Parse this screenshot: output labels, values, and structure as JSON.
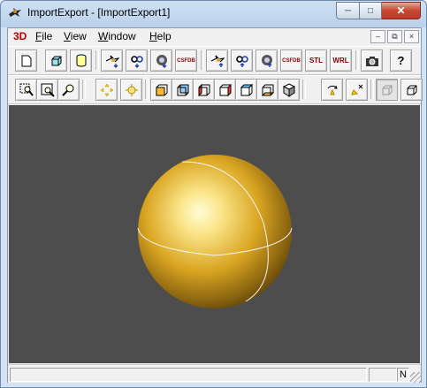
{
  "window": {
    "title": "ImportExport - [ImportExport1]"
  },
  "menu": {
    "logo": "3D",
    "items": [
      {
        "underline": "F",
        "rest": "ile"
      },
      {
        "underline": "V",
        "rest": "iew"
      },
      {
        "underline": "W",
        "rest": "indow"
      },
      {
        "underline": "H",
        "rest": "elp"
      }
    ]
  },
  "toolbar1": {
    "csfdb_label": "CSFDB",
    "stl_label": "STL",
    "wrl_label": "WRL",
    "help_label": "?"
  },
  "status": {
    "pane3": "N"
  },
  "scene": {
    "background": "#4d4d4d",
    "sphere_color": "#d9a521"
  }
}
